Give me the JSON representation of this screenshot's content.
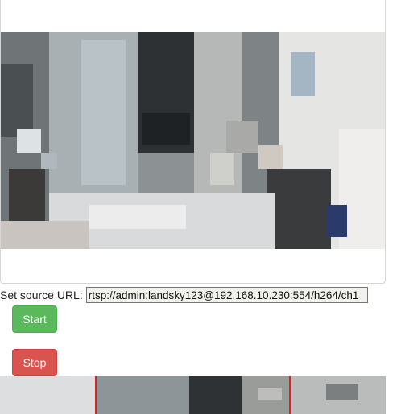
{
  "video": {
    "main_label": "camera-stream-frame",
    "preview_label": "processed-stream-frame"
  },
  "source": {
    "label": "Set source URL:",
    "url_value": "rtsp://admin:landsky123@192.168.10.230:554/h264/ch1"
  },
  "controls": {
    "start_label": "Start",
    "stop_label": "Stop"
  },
  "colors": {
    "start": "#5cb85c",
    "stop": "#d9534f",
    "detection_line": "#e02020"
  }
}
